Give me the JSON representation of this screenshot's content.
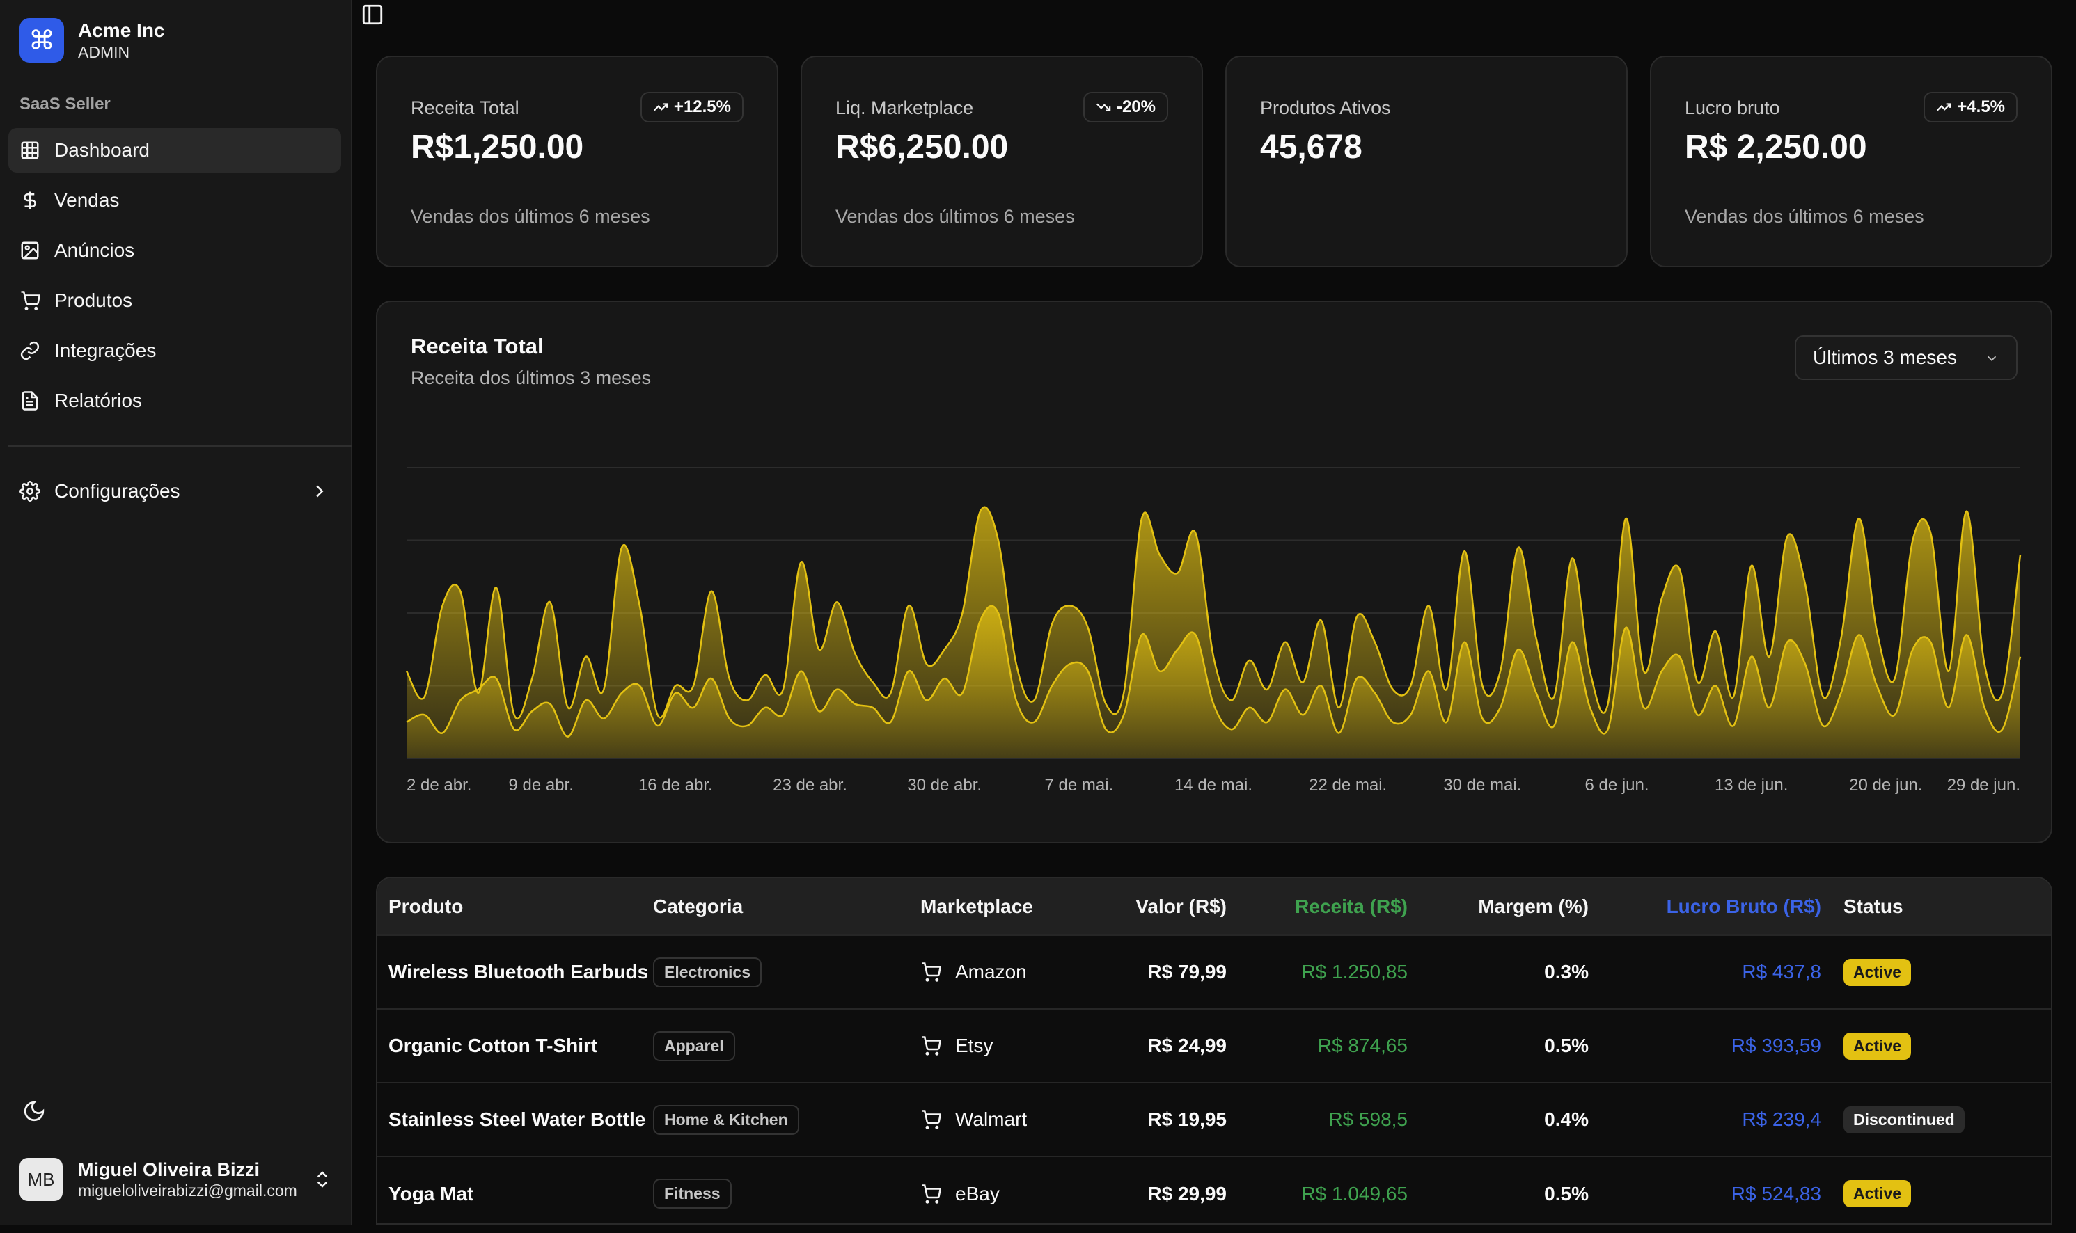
{
  "brand": {
    "logo_glyph": "⌘",
    "name": "Acme Inc",
    "role": "ADMIN",
    "logo_color": "#2f5be8"
  },
  "sidebar": {
    "group_label": "SaaS Seller",
    "items": [
      {
        "label": "Dashboard",
        "icon": "grid-icon",
        "active": true
      },
      {
        "label": "Vendas",
        "icon": "dollar-icon"
      },
      {
        "label": "Anúncios",
        "icon": "image-icon"
      },
      {
        "label": "Produtos",
        "icon": "cart-icon"
      },
      {
        "label": "Integrações",
        "icon": "link-icon"
      },
      {
        "label": "Relatórios",
        "icon": "file-icon"
      }
    ],
    "settings_label": "Configurações"
  },
  "user": {
    "initials": "MB",
    "name": "Miguel Oliveira Bizzi",
    "email": "migueloliveirabizzi@gmail.com"
  },
  "stats": [
    {
      "title": "Receita Total",
      "value": "R$1,250.00",
      "trend": "+12.5%",
      "trend_dir": "up",
      "sub": "Vendas dos últimos 6 meses"
    },
    {
      "title": "Liq. Marketplace",
      "value": "R$6,250.00",
      "trend": "-20%",
      "trend_dir": "down",
      "sub": "Vendas dos últimos 6 meses"
    },
    {
      "title": "Produtos Ativos",
      "value": "45,678",
      "trend": "",
      "trend_dir": "",
      "sub": ""
    },
    {
      "title": "Lucro bruto",
      "value": "R$ 2,250.00",
      "trend": "+4.5%",
      "trend_dir": "up",
      "sub": "Vendas dos últimos 6 meses"
    }
  ],
  "revenue_chart": {
    "title": "Receita Total",
    "subtitle": "Receita dos últimos 3 meses",
    "range_selected": "Últimos 3 meses",
    "accent": "#e3c112"
  },
  "chart_data": {
    "type": "area",
    "x_tick_labels": [
      "2 de abr.",
      "9 de abr.",
      "16 de abr.",
      "23 de abr.",
      "30 de abr.",
      "7 de mai.",
      "14 de mai.",
      "22 de mai.",
      "30 de mai.",
      "6 de jun.",
      "13 de jun.",
      "20 de jun.",
      "29 de jun."
    ],
    "grid": "horizontal",
    "ylim": [
      0,
      400
    ],
    "series": [
      {
        "values": [
          120,
          85,
          210,
          230,
          90,
          235,
          60,
          110,
          215,
          70,
          140,
          95,
          290,
          210,
          60,
          100,
          100,
          230,
          110,
          80,
          115,
          95,
          270,
          150,
          215,
          145,
          105,
          90,
          210,
          130,
          150,
          200,
          340,
          300,
          130,
          80,
          185,
          210,
          180,
          75,
          90,
          330,
          280,
          255,
          310,
          140,
          80,
          135,
          95,
          160,
          105,
          190,
          70,
          195,
          160,
          95,
          100,
          210,
          95,
          285,
          100,
          120,
          290,
          165,
          85,
          275,
          120,
          75,
          330,
          120,
          220,
          260,
          105,
          175,
          85,
          265,
          140,
          305,
          240,
          85,
          165,
          330,
          175,
          110,
          300,
          310,
          120,
          340,
          130,
          90,
          280
        ]
      },
      {
        "values": [
          50,
          60,
          35,
          80,
          95,
          110,
          40,
          65,
          75,
          30,
          80,
          55,
          90,
          100,
          45,
          90,
          70,
          110,
          55,
          45,
          70,
          60,
          120,
          65,
          95,
          75,
          70,
          50,
          120,
          80,
          110,
          90,
          190,
          200,
          80,
          50,
          100,
          130,
          120,
          40,
          60,
          170,
          120,
          150,
          170,
          75,
          40,
          70,
          50,
          95,
          60,
          100,
          35,
          110,
          90,
          50,
          60,
          120,
          50,
          160,
          55,
          70,
          150,
          90,
          45,
          160,
          70,
          40,
          180,
          70,
          120,
          140,
          60,
          100,
          45,
          140,
          70,
          160,
          130,
          45,
          90,
          170,
          100,
          60,
          150,
          160,
          70,
          170,
          70,
          40,
          140
        ]
      }
    ]
  },
  "table": {
    "headers": [
      "Produto",
      "Categoria",
      "Marketplace",
      "Valor (R$)",
      "Receita (R$)",
      "Margem (%)",
      "Lucro Bruto (R$)",
      "Status"
    ],
    "rows": [
      {
        "produto": "Wireless Bluetooth Earbuds",
        "categoria": "Electronics",
        "marketplace": "Amazon",
        "valor": "R$ 79,99",
        "receita": "R$ 1.250,85",
        "margem": "0.3%",
        "lucro": "R$ 437,8",
        "status": "Active"
      },
      {
        "produto": "Organic Cotton T-Shirt",
        "categoria": "Apparel",
        "marketplace": "Etsy",
        "valor": "R$ 24,99",
        "receita": "R$ 874,65",
        "margem": "0.5%",
        "lucro": "R$ 393,59",
        "status": "Active"
      },
      {
        "produto": "Stainless Steel Water Bottle",
        "categoria": "Home & Kitchen",
        "marketplace": "Walmart",
        "valor": "R$ 19,95",
        "receita": "R$ 598,5",
        "margem": "0.4%",
        "lucro": "R$ 239,4",
        "status": "Discontinued"
      },
      {
        "produto": "Yoga Mat",
        "categoria": "Fitness",
        "marketplace": "eBay",
        "valor": "R$ 29,99",
        "receita": "R$ 1.049,65",
        "margem": "0.5%",
        "lucro": "R$ 524,83",
        "status": "Active"
      }
    ]
  }
}
